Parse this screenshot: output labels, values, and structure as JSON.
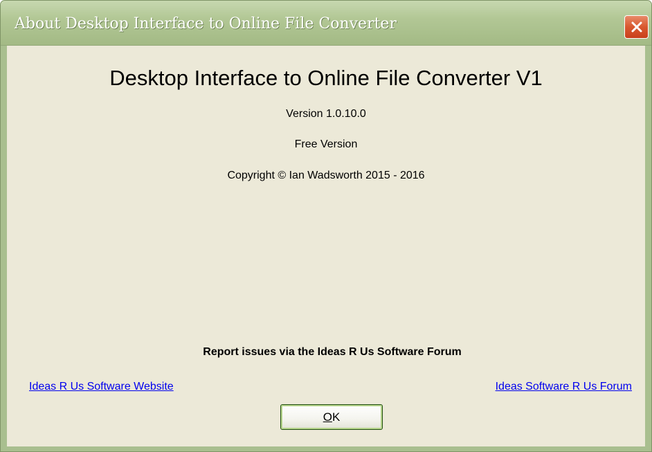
{
  "window": {
    "title": "About Desktop Interface to Online File Converter",
    "close_icon": "close-icon"
  },
  "content": {
    "app_title": "Desktop Interface to Online File Converter V1",
    "version": "Version 1.0.10.0",
    "edition": "Free Version",
    "copyright": "Copyright © Ian Wadsworth 2015 - 2016",
    "report_issues": "Report issues via the Ideas R Us Software Forum"
  },
  "links": {
    "website": "Ideas R Us Software Website",
    "forum": "Ideas Software R Us Forum"
  },
  "buttons": {
    "ok_mnemonic": "O",
    "ok_rest": "K"
  },
  "colors": {
    "titlebar": "#a9bf8f",
    "client_background": "#ece9d8",
    "link": "#0000ee",
    "close_button": "#d9582f"
  }
}
